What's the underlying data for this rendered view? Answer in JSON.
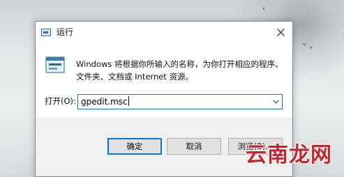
{
  "dialog": {
    "title": "运行",
    "close_icon": "close-icon",
    "description_line1": "Windows 将根据你所输入的名称，为你打开相应的程序、",
    "description_line2": "文件夹、文档或 Internet 资源。",
    "open_label": "打开(O):",
    "open_value": "gpedit.msc",
    "buttons": {
      "ok": "确定",
      "cancel": "取消",
      "browse": "浏览(B)..."
    }
  },
  "watermark": "云南龙网",
  "colors": {
    "accent": "#0078d7",
    "button_bar": "#f0f0f0",
    "watermark": "#c1272d"
  }
}
